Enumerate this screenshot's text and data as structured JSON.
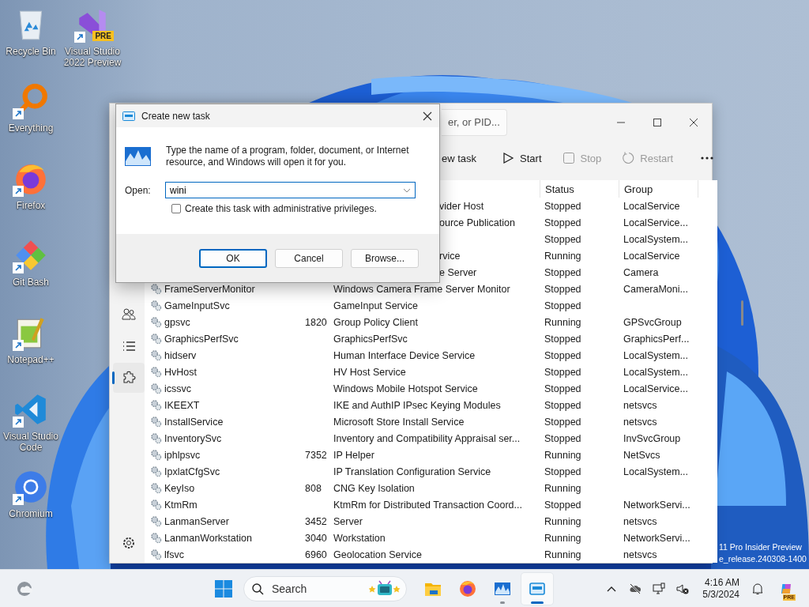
{
  "desktop": {
    "icons": [
      {
        "label": "Recycle Bin",
        "shortcut": false
      },
      {
        "label": "Visual Studio 2022 Preview",
        "shortcut": true,
        "badge": "PRE"
      },
      {
        "label": "Everything",
        "shortcut": true
      },
      {
        "label": "Firefox",
        "shortcut": true
      },
      {
        "label": "Git Bash",
        "shortcut": true
      },
      {
        "label": "Notepad++",
        "shortcut": true
      },
      {
        "label": "Visual Studio Code",
        "shortcut": true
      },
      {
        "label": "Chromium",
        "shortcut": true
      }
    ],
    "watermark_lines": [
      "11 Pro Insider Preview",
      "e_release.240308-1400"
    ]
  },
  "task_manager": {
    "search_placeholder": "er, or PID...",
    "toolbar": [
      {
        "label": "ew task",
        "disabled": false
      },
      {
        "label": "Start",
        "disabled": false
      },
      {
        "label": "Stop",
        "disabled": true
      },
      {
        "label": "Restart",
        "disabled": true
      }
    ],
    "nav": [
      {
        "selected": false
      },
      {
        "selected": false
      },
      {
        "selected": true
      }
    ],
    "columns": [
      "Status",
      "Group"
    ],
    "rows": [
      {
        "description_fragment": "vider Host",
        "status": "Stopped",
        "group": "LocalService"
      },
      {
        "description_fragment": "ource Publication",
        "status": "Stopped",
        "group": "LocalService..."
      },
      {
        "status": "Stopped",
        "group": "LocalSystem..."
      },
      {
        "description_fragment": "rvice",
        "status": "Running",
        "group": "LocalService"
      },
      {
        "description_fragment": "e Server",
        "status": "Stopped",
        "group": "Camera"
      },
      {
        "name": "FrameServerMonitor",
        "description": "Windows Camera Frame Server Monitor",
        "status": "Stopped",
        "group": "CameraMoni..."
      },
      {
        "name": "GameInputSvc",
        "description": "GameInput Service",
        "status": "Stopped"
      },
      {
        "name": "gpsvc",
        "pid": "1820",
        "description": "Group Policy Client",
        "status": "Running",
        "group": "GPSvcGroup"
      },
      {
        "name": "GraphicsPerfSvc",
        "description": "GraphicsPerfSvc",
        "status": "Stopped",
        "group": "GraphicsPerf..."
      },
      {
        "name": "hidserv",
        "description": "Human Interface Device Service",
        "status": "Stopped",
        "group": "LocalSystem..."
      },
      {
        "name": "HvHost",
        "description": "HV Host Service",
        "status": "Stopped",
        "group": "LocalSystem..."
      },
      {
        "name": "icssvc",
        "description": "Windows Mobile Hotspot Service",
        "status": "Stopped",
        "group": "LocalService..."
      },
      {
        "name": "IKEEXT",
        "description": "IKE and AuthIP IPsec Keying Modules",
        "status": "Stopped",
        "group": "netsvcs"
      },
      {
        "name": "InstallService",
        "description": "Microsoft Store Install Service",
        "status": "Stopped",
        "group": "netsvcs"
      },
      {
        "name": "InventorySvc",
        "description": "Inventory and Compatibility Appraisal ser...",
        "status": "Stopped",
        "group": "InvSvcGroup"
      },
      {
        "name": "iphlpsvc",
        "pid": "7352",
        "description": "IP Helper",
        "status": "Running",
        "group": "NetSvcs"
      },
      {
        "name": "IpxlatCfgSvc",
        "description": "IP Translation Configuration Service",
        "status": "Stopped",
        "group": "LocalSystem..."
      },
      {
        "name": "KeyIso",
        "pid": "808",
        "description": "CNG Key Isolation",
        "status": "Running"
      },
      {
        "name": "KtmRm",
        "description": "KtmRm for Distributed Transaction Coord...",
        "status": "Stopped",
        "group": "NetworkServi..."
      },
      {
        "name": "LanmanServer",
        "pid": "3452",
        "description": "Server",
        "status": "Running",
        "group": "netsvcs"
      },
      {
        "name": "LanmanWorkstation",
        "pid": "3040",
        "description": "Workstation",
        "status": "Running",
        "group": "NetworkServi..."
      },
      {
        "name": "lfsvc",
        "pid": "6960",
        "description": "Geolocation Service",
        "status": "Running",
        "group": "netsvcs"
      }
    ]
  },
  "dialog": {
    "title": "Create new task",
    "message": "Type the name of a program, folder, document, or Internet resource, and Windows will open it for you.",
    "open_label": "Open:",
    "value": "wini",
    "admin_checkbox": {
      "label": "Create this task with administrative privileges.",
      "checked": false
    },
    "buttons": [
      {
        "label": "OK",
        "default": true
      },
      {
        "label": "Cancel",
        "default": false
      },
      {
        "label": "Browse...",
        "default": false
      }
    ]
  },
  "taskbar": {
    "search_placeholder": "Search",
    "apps": [
      {
        "running": false,
        "active": false
      },
      {
        "running": false,
        "active": false
      },
      {
        "running": true,
        "active": false
      },
      {
        "running": true,
        "active": true
      }
    ],
    "time": "4:16 AM",
    "date": "5/3/2024",
    "copilot_badge": "PRE"
  }
}
